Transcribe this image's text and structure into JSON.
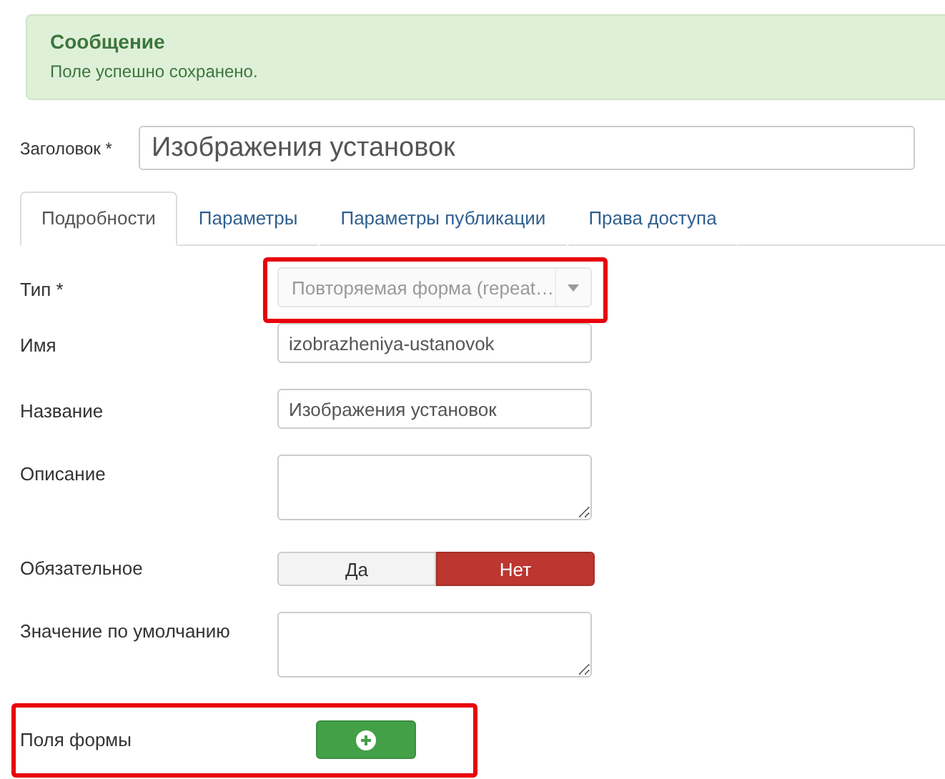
{
  "message": {
    "title": "Сообщение",
    "text": "Поле успешно сохранено."
  },
  "title_field": {
    "label": "Заголовок *",
    "value": "Изображения установок"
  },
  "tabs": [
    {
      "label": "Подробности",
      "selected": true
    },
    {
      "label": "Параметры",
      "selected": false
    },
    {
      "label": "Параметры публикации",
      "selected": false
    },
    {
      "label": "Права доступа",
      "selected": false
    }
  ],
  "rows": [
    {
      "kind": "select",
      "label": "Тип *",
      "value": "Повторяемая форма (repeat…",
      "disabled": true,
      "highlighted": true
    },
    {
      "kind": "text",
      "label": "Имя",
      "value": "izobrazheniya-ustanovok",
      "highlighted": false
    },
    {
      "kind": "text",
      "label": "Название",
      "value": "Изображения установок",
      "highlighted": false
    },
    {
      "kind": "textarea",
      "label": "Описание",
      "highlighted": false
    },
    {
      "kind": "toggle",
      "label": "Обязательное",
      "options": [
        {
          "label": "Да",
          "selected": false
        },
        {
          "label": "Нет",
          "selected": true
        }
      ],
      "highlighted": false
    },
    {
      "kind": "textarea",
      "label": "Значение по умолчанию",
      "highlighted": false
    },
    {
      "kind": "add",
      "label": "Поля формы",
      "highlighted": true
    }
  ]
}
